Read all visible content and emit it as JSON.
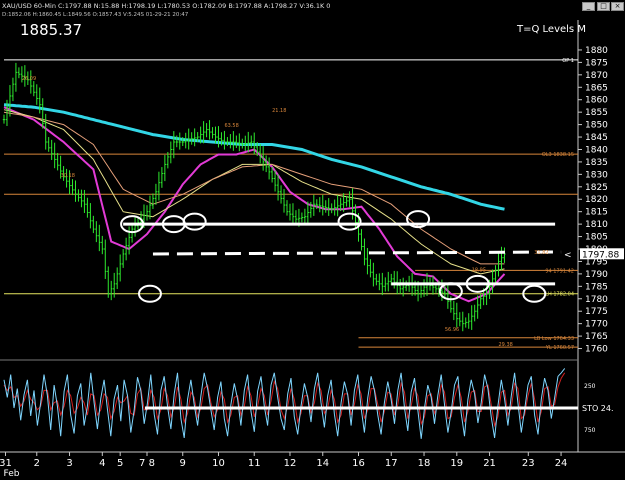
{
  "header": {
    "ohlc": "XAU/USD 60-Min  C:1797.88  N:15.88  H:1798.19  L:1780.53  O:1782.09  B:1797.88  A:1798.27  V:36.1K  0",
    "sub": "D:1852.06  H:1860.45  L:1849.56  O:1857.43  V:5.24S  01-29-21 20:47",
    "big_price": "1885.37",
    "title_right": "T=Q Levels M",
    "window_buttons": [
      "_",
      "□",
      "×"
    ]
  },
  "colors": {
    "background": "#000000",
    "price_bar": "#2eea2e",
    "ma_cyan": "#33d6e6",
    "ma_magenta": "#e23bd6",
    "ma_yellow": "#e6e08a",
    "ma_salmon": "#e6a07a",
    "stoch_fast": "#7fd6ff",
    "stoch_slow": "#d02020",
    "level_orange": "#d8863b",
    "level_yellow": "#e6e660",
    "annotation_white": "#ffffff"
  },
  "chart_data": {
    "type": "candlestick",
    "title": "",
    "price_axis": {
      "ylim": [
        1757,
        1884
      ],
      "ticks": [
        1760,
        1765,
        1770,
        1775,
        1780,
        1785,
        1790,
        1795,
        1800,
        1805,
        1810,
        1815,
        1820,
        1825,
        1830,
        1835,
        1840,
        1845,
        1850,
        1855,
        1860,
        1865,
        1870,
        1875,
        1880
      ],
      "last_price": "1797.88",
      "last_price_arrow": "<",
      "grid": false
    },
    "x_axis": {
      "tick_labels": [
        "31",
        "2",
        "3",
        "4",
        "5",
        "7 8",
        "9",
        "10",
        "11",
        "12",
        "14",
        "16",
        "17",
        "18",
        "19",
        "21",
        "23",
        "24"
      ],
      "tick_index": [
        0.5,
        11,
        22,
        33,
        39,
        48,
        60,
        72,
        84,
        96,
        107,
        119,
        130,
        141,
        152,
        163,
        176,
        187
      ],
      "month_label": "Feb",
      "n_bars": 190
    },
    "series": [
      {
        "name": "",
        "kind": "close",
        "x": [
          0,
          4,
          8,
          12,
          14,
          17,
          20,
          24,
          27,
          30,
          33,
          35,
          37,
          40,
          43,
          46,
          48,
          51,
          54,
          57,
          60,
          62,
          65,
          68,
          71,
          74,
          77,
          80,
          83,
          86,
          89,
          92,
          95,
          98,
          101,
          104,
          107,
          110,
          113,
          116,
          119,
          121,
          124,
          127,
          130,
          133,
          136,
          139,
          142,
          145,
          148,
          150,
          152,
          154,
          156,
          158,
          160,
          162,
          164,
          166,
          168
        ],
        "y": [
          1852,
          1871,
          1868,
          1858,
          1843,
          1836,
          1829,
          1822,
          1818,
          1808,
          1800,
          1782,
          1786,
          1798,
          1808,
          1812,
          1815,
          1823,
          1834,
          1843,
          1843,
          1844,
          1845,
          1848,
          1845,
          1843,
          1843,
          1842,
          1843,
          1837,
          1831,
          1823,
          1815,
          1812,
          1813,
          1818,
          1817,
          1816,
          1818,
          1820,
          1806,
          1796,
          1788,
          1785,
          1788,
          1784,
          1786,
          1782,
          1786,
          1784,
          1782,
          1776,
          1772,
          1770,
          1771,
          1775,
          1780,
          1782,
          1788,
          1795,
          1798
        ]
      },
      {
        "name": "",
        "kind": "ma",
        "color": "ma_cyan",
        "x": [
          0,
          10,
          20,
          30,
          40,
          50,
          60,
          70,
          80,
          90,
          100,
          110,
          120,
          130,
          140,
          150,
          160,
          168
        ],
        "y": [
          1858,
          1857,
          1855,
          1852,
          1849,
          1846,
          1844,
          1843,
          1842,
          1842,
          1840,
          1836,
          1833,
          1829,
          1825,
          1822,
          1818,
          1816
        ]
      },
      {
        "name": "",
        "kind": "ma",
        "color": "ma_magenta",
        "x": [
          0,
          10,
          20,
          30,
          36,
          42,
          48,
          54,
          60,
          66,
          72,
          78,
          84,
          90,
          96,
          102,
          108,
          114,
          120,
          126,
          132,
          138,
          144,
          150,
          156,
          162,
          168
        ],
        "y": [
          1857,
          1852,
          1843,
          1832,
          1803,
          1800,
          1806,
          1815,
          1826,
          1834,
          1838,
          1838,
          1840,
          1833,
          1823,
          1818,
          1816,
          1816,
          1817,
          1808,
          1797,
          1790,
          1789,
          1782,
          1779,
          1782,
          1790
        ]
      },
      {
        "name": "",
        "kind": "ma",
        "color": "ma_yellow",
        "x": [
          0,
          10,
          20,
          30,
          40,
          50,
          60,
          70,
          80,
          90,
          100,
          110,
          120,
          130,
          140,
          150,
          160,
          168
        ],
        "y": [
          1856,
          1853,
          1848,
          1836,
          1815,
          1813,
          1820,
          1828,
          1834,
          1834,
          1827,
          1822,
          1820,
          1812,
          1802,
          1794,
          1790,
          1792
        ]
      },
      {
        "name": "",
        "kind": "ma",
        "color": "ma_salmon",
        "x": [
          0,
          10,
          20,
          30,
          40,
          50,
          60,
          70,
          80,
          90,
          100,
          110,
          120,
          130,
          140,
          150,
          160,
          168
        ],
        "y": [
          1855,
          1853,
          1850,
          1842,
          1824,
          1818,
          1822,
          1828,
          1833,
          1834,
          1830,
          1826,
          1824,
          1818,
          1808,
          1800,
          1794,
          1794
        ]
      }
    ],
    "levels": [
      {
        "value": 1876,
        "color": "annotation_white",
        "label": "OP 1",
        "x_start": 0
      },
      {
        "value": 1838.15,
        "color": "level_orange",
        "label": "OL3 1838.15",
        "x_start": 0
      },
      {
        "value": 1822,
        "color": "level_orange",
        "label": "",
        "x_start": 0
      },
      {
        "value": 1791.42,
        "color": "level_orange",
        "label": "94 1791.42",
        "x_start": 138
      },
      {
        "value": 1782.04,
        "color": "level_yellow",
        "label": "LH 1782.04",
        "x_start": 0
      },
      {
        "value": 1764.33,
        "color": "level_orange",
        "label": "LB Low 1764.33",
        "x_start": 119
      },
      {
        "value": 1760.57,
        "color": "level_orange",
        "label": "YL 1760.57",
        "x_start": 119
      }
    ],
    "annotations": {
      "solid_lines": [
        {
          "y": 1810,
          "x1": 40,
          "x2": 185
        },
        {
          "y": 1786,
          "x1": 130,
          "x2": 185
        }
      ],
      "dashed_lines": [
        {
          "y": 1798,
          "x1": 50,
          "x2": 187
        }
      ],
      "ellipses": [
        {
          "x": 43,
          "y": 1810
        },
        {
          "x": 49,
          "y": 1782
        },
        {
          "x": 57,
          "y": 1810
        },
        {
          "x": 64,
          "y": 1811
        },
        {
          "x": 116,
          "y": 1811
        },
        {
          "x": 139,
          "y": 1812
        },
        {
          "x": 150,
          "y": 1783
        },
        {
          "x": 159,
          "y": 1786
        },
        {
          "x": 178,
          "y": 1782
        }
      ],
      "chart_labels": [
        {
          "text": "26.09",
          "x": 6,
          "y": 1868
        },
        {
          "text": "30.18",
          "x": 19,
          "y": 1829
        },
        {
          "text": "63.58",
          "x": 74,
          "y": 1849
        },
        {
          "text": "21.18",
          "x": 90,
          "y": 1855
        },
        {
          "text": "56.96",
          "x": 148,
          "y": 1767
        },
        {
          "text": "29.38",
          "x": 166,
          "y": 1761
        },
        {
          "text": "18.95",
          "x": 157,
          "y": 1791
        },
        {
          "text": "31.82",
          "x": 178,
          "y": 1798
        }
      ]
    },
    "stochastic": {
      "ylim": [
        0,
        1000
      ],
      "tick_labels": [
        {
          "text": "250",
          "value": 750
        },
        {
          "text": "750",
          "value": 250
        }
      ],
      "readout": "STO  24.",
      "hline": 500,
      "fast": [
        820,
        620,
        880,
        500,
        720,
        360,
        650,
        820,
        410,
        700,
        300,
        560,
        880,
        640,
        250,
        760,
        520,
        180,
        690,
        880,
        420,
        210,
        640,
        780,
        300,
        520,
        900,
        560,
        260,
        610,
        820,
        480,
        180,
        600,
        760,
        350,
        820,
        640,
        220,
        480,
        850,
        700,
        320,
        560,
        880,
        430,
        200,
        700,
        860,
        520,
        260,
        660,
        900,
        380,
        160,
        600,
        820,
        540,
        300,
        640,
        900,
        720,
        480,
        250,
        620,
        800,
        380,
        180,
        540,
        780,
        600,
        300,
        700,
        880,
        460,
        230,
        690,
        860,
        520,
        300,
        760,
        900,
        620,
        380,
        250,
        660,
        840,
        400,
        200,
        520,
        780,
        620,
        340,
        720,
        900,
        560,
        280,
        640,
        820,
        430,
        180,
        560,
        800,
        650,
        300,
        700,
        880,
        500,
        220,
        620,
        860,
        700,
        420,
        200,
        560,
        800,
        600,
        320,
        700,
        900,
        500,
        240,
        680,
        840,
        480,
        150,
        500,
        760,
        620,
        320,
        640,
        880,
        540,
        220,
        460,
        760,
        860,
        440,
        180,
        600,
        820,
        660,
        330,
        560,
        880,
        720,
        400,
        160,
        520,
        820,
        600,
        300,
        640,
        900,
        560,
        220,
        480,
        760,
        860,
        420,
        200,
        600,
        840,
        700,
        380,
        620,
        860,
        900,
        950
      ],
      "slow": [
        760,
        700,
        740,
        620,
        640,
        520,
        580,
        700,
        600,
        560,
        480,
        520,
        700,
        700,
        480,
        560,
        580,
        420,
        520,
        700,
        640,
        440,
        500,
        620,
        560,
        420,
        660,
        640,
        420,
        480,
        660,
        620,
        380,
        460,
        620,
        560,
        580,
        640,
        440,
        420,
        660,
        720,
        480,
        480,
        700,
        620,
        380,
        480,
        720,
        640,
        400,
        500,
        740,
        600,
        340,
        440,
        680,
        620,
        400,
        500,
        720,
        760,
        560,
        400,
        480,
        680,
        600,
        340,
        420,
        620,
        640,
        420,
        520,
        740,
        640,
        400,
        520,
        720,
        640,
        420,
        580,
        800,
        720,
        480,
        380,
        520,
        720,
        600,
        340,
        440,
        640,
        640,
        440,
        560,
        780,
        700,
        440,
        500,
        700,
        600,
        340,
        420,
        660,
        660,
        420,
        540,
        760,
        660,
        380,
        480,
        720,
        720,
        540,
        340,
        460,
        680,
        660,
        420,
        540,
        780,
        680,
        380,
        520,
        720,
        640,
        320,
        400,
        640,
        660,
        440,
        520,
        760,
        680,
        380,
        400,
        620,
        760,
        620,
        340,
        460,
        680,
        700,
        460,
        460,
        740,
        760,
        540,
        300,
        400,
        680,
        700,
        420,
        500,
        780,
        720,
        380,
        420,
        640,
        780,
        600,
        340,
        460,
        720,
        740,
        520,
        540,
        740,
        840,
        900
      ]
    }
  }
}
